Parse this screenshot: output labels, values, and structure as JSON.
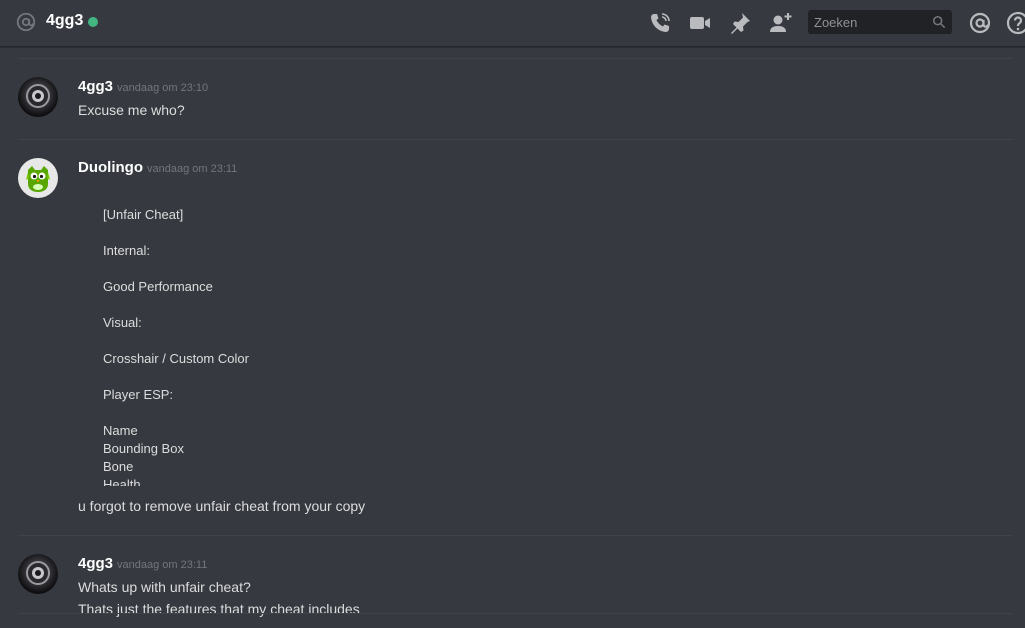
{
  "header": {
    "channel_name": "4gg3",
    "status": "online",
    "status_color": "#43b581",
    "search_placeholder": "Zoeken",
    "icons": [
      "at-icon",
      "call-icon",
      "video-icon",
      "pin-icon",
      "add-friend-icon",
      "search-icon",
      "mention-icon",
      "help-icon"
    ]
  },
  "messages": [
    {
      "author": "4gg3",
      "timestamp": "vandaag om 23:10",
      "avatar": "dark-helmet-avatar",
      "lines": [
        "Excuse me who?"
      ]
    },
    {
      "author": "Duolingo",
      "timestamp": "vandaag om 23:11",
      "avatar": "duolingo-owl-avatar",
      "embed_lines": [
        "[Unfair Cheat]",
        "",
        "Internal:",
        "",
        "Good Performance",
        "",
        "Visual:",
        "",
        "Crosshair / Custom Color",
        "",
        "Player ESP:",
        "",
        "Name",
        "Bounding Box",
        "Bone",
        "Health"
      ],
      "lines": [
        "u forgot to remove unfair cheat from your copy"
      ]
    },
    {
      "author": "4gg3",
      "timestamp": "vandaag om 23:11",
      "avatar": "dark-helmet-avatar",
      "lines": [
        "Whats up with unfair cheat?",
        "Thats just the features that my cheat includes"
      ]
    }
  ]
}
